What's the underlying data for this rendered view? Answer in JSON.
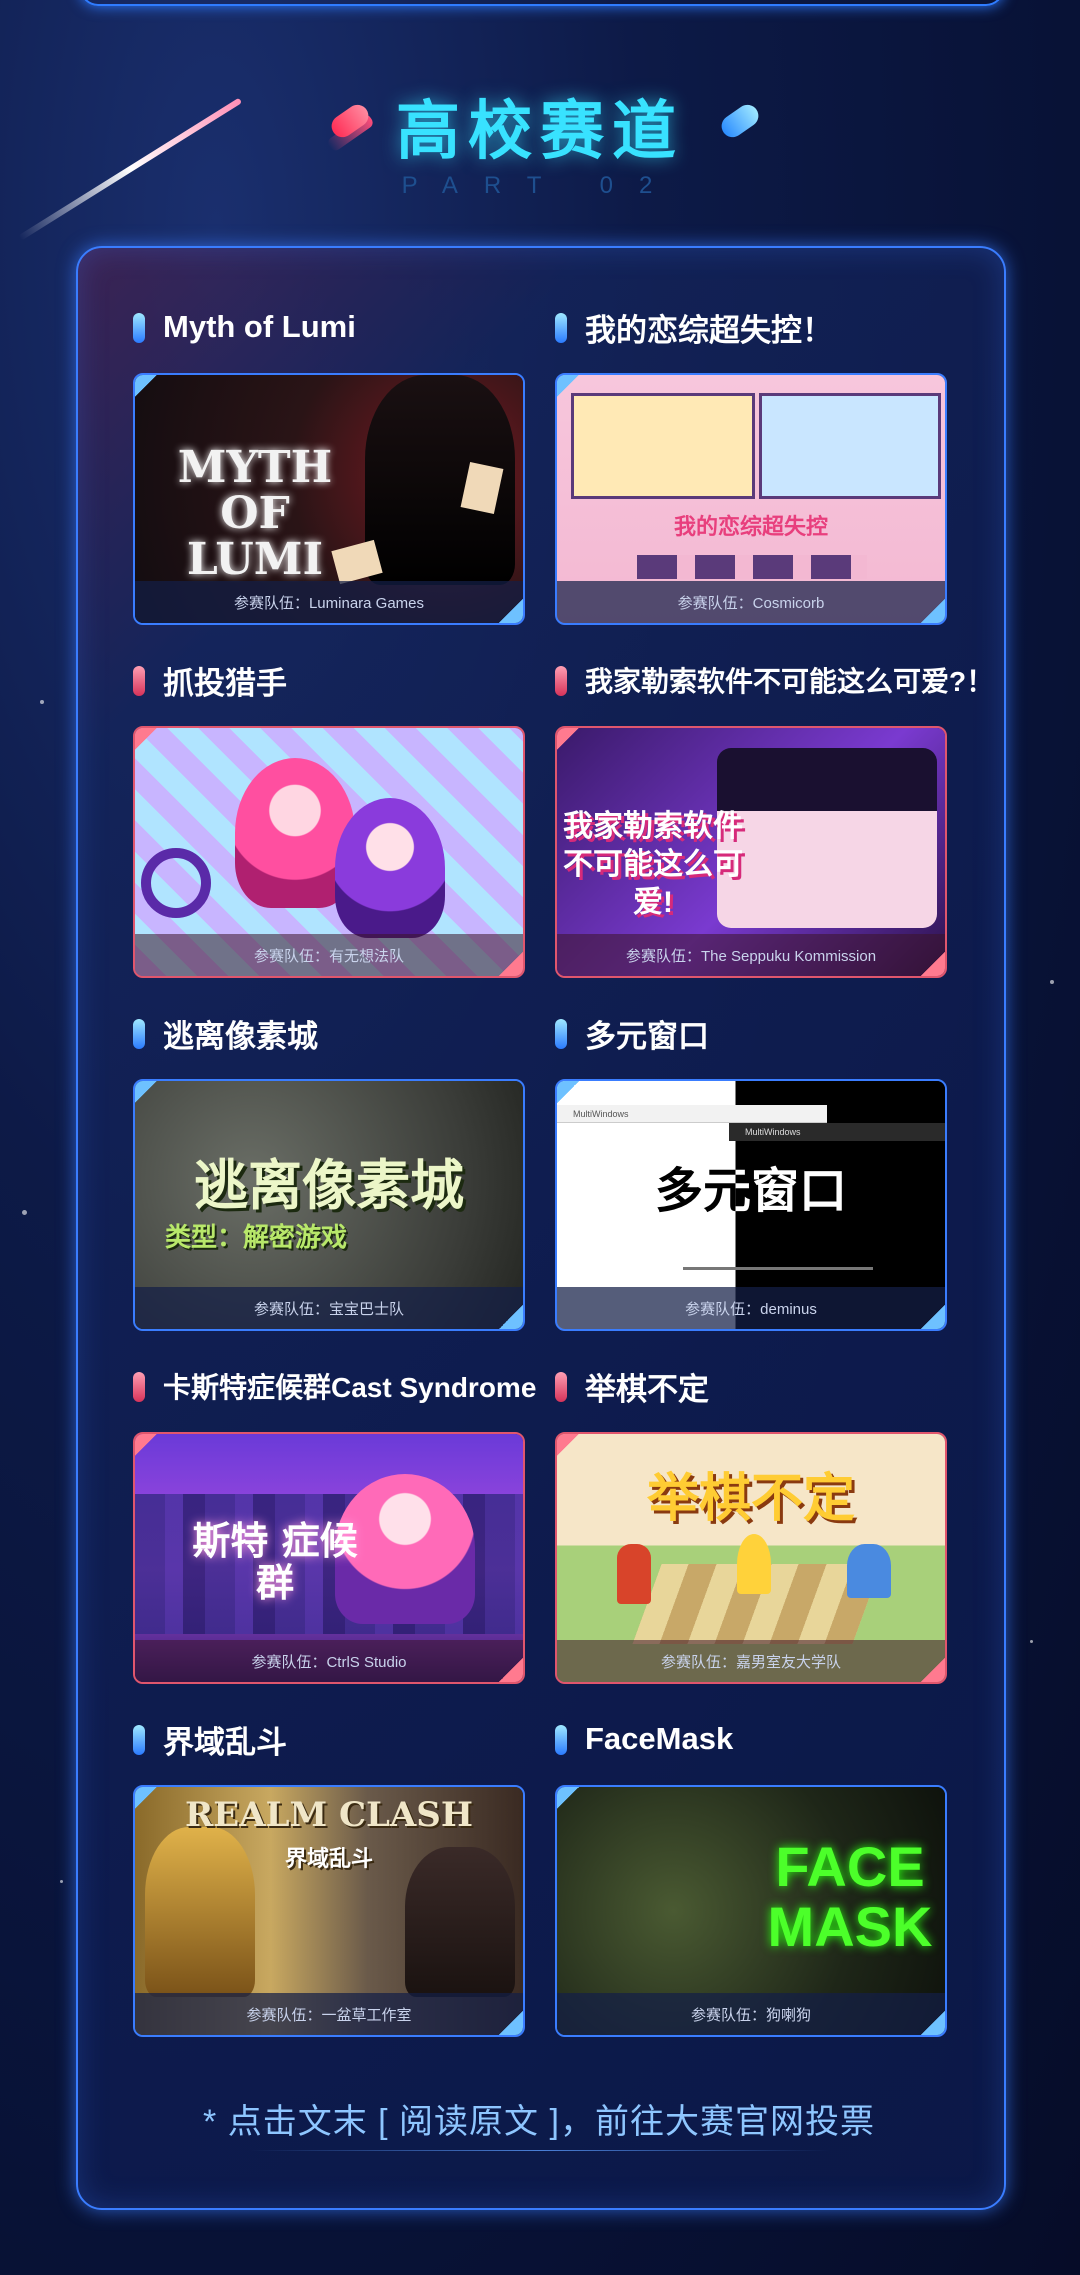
{
  "header": {
    "title": "高校赛道",
    "subtitle": "PART 02"
  },
  "cards": [
    {
      "title": "Myth of Lumi",
      "art_text": "MYTH OF LUMI",
      "team": "参赛队伍：Luminara Games",
      "accent": "blue"
    },
    {
      "title": "我的恋综超失控！",
      "art_text": "我的恋综超失控",
      "team": "参赛队伍：Cosmicorb",
      "accent": "blue"
    },
    {
      "title": "抓投猎手",
      "art_text": "",
      "team": "参赛队伍：有无想法队",
      "accent": "red"
    },
    {
      "title": "我家勒索软件不可能这么可爱?！",
      "art_text": "我家勒索软件不可能这么可爱!",
      "team": "参赛队伍：The Seppuku Kommission",
      "accent": "red"
    },
    {
      "title": "逃离像素城",
      "art_text": "逃离像素城",
      "art_subtext": "类型：解密游戏",
      "team": "参赛队伍：宝宝巴士队",
      "accent": "blue"
    },
    {
      "title": "多元窗口",
      "art_text": "多元窗口",
      "art_window_a": "MultiWindows",
      "art_window_b": "MultiWindows",
      "team": "参赛队伍：deminus",
      "accent": "blue"
    },
    {
      "title": "卡斯特症候群Cast Syndrome",
      "art_text": "斯特 症候群",
      "team": "参赛队伍：CtrlS Studio",
      "accent": "red"
    },
    {
      "title": "举棋不定",
      "art_text": "举棋不定",
      "team": "参赛队伍：嘉男室友大学队",
      "accent": "red"
    },
    {
      "title": "界域乱斗",
      "art_text": "REALM CLASH",
      "art_subtext": "界域乱斗",
      "team": "参赛队伍：一盆草工作室",
      "accent": "blue"
    },
    {
      "title": "FaceMask",
      "art_text": "FACE MASK",
      "team": "参赛队伍：狗喇狗",
      "accent": "blue"
    }
  ],
  "footer": {
    "note": "* 点击文末 [ 阅读原文 ]，前往大赛官网投票"
  },
  "colors": {
    "accent_cyan": "#38e2ff",
    "frame_blue": "#3a7dff",
    "accent_red": "#e0566d"
  }
}
